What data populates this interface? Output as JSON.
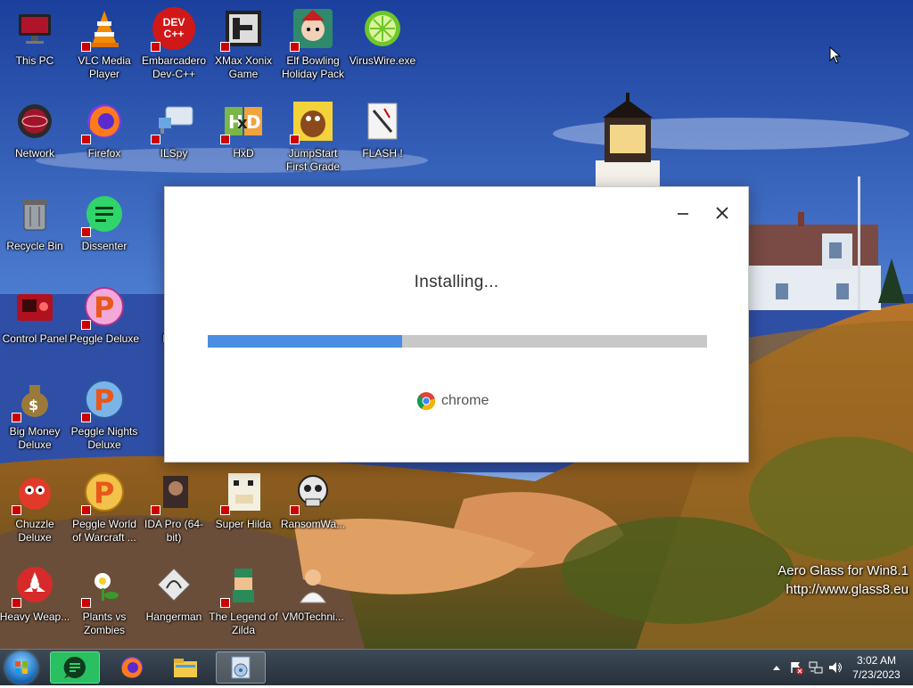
{
  "desktop": {
    "icons": [
      {
        "label": "This PC",
        "icon": "monitor-icon"
      },
      {
        "label": "VLC Media Player",
        "icon": "vlc-cone-icon"
      },
      {
        "label": "Embarcadero Dev-C++",
        "icon": "devcpp-icon",
        "badge": "DEV C++"
      },
      {
        "label": "XMax Xonix Game",
        "icon": "xonix-icon"
      },
      {
        "label": "Elf Bowling Holiday Pack",
        "icon": "elf-bowling-icon"
      },
      {
        "label": "VirusWire.exe",
        "icon": "lime-icon"
      },
      {
        "label": "Network",
        "icon": "network-icon"
      },
      {
        "label": "Firefox",
        "icon": "firefox-icon"
      },
      {
        "label": "ILSpy",
        "icon": "ilspy-icon"
      },
      {
        "label": "HxD",
        "icon": "hxd-icon"
      },
      {
        "label": "JumpStart First Grade",
        "icon": "jumpstart-icon"
      },
      {
        "label": "FLASH !",
        "icon": "flash-icon"
      },
      {
        "label": "Recycle Bin",
        "icon": "recycle-bin-icon"
      },
      {
        "label": "Dissenter",
        "icon": "dissenter-icon"
      },
      {
        "label": "d",
        "icon": "partial-icon"
      },
      {
        "label": "Control Panel",
        "icon": "control-panel-icon"
      },
      {
        "label": "Peggle Deluxe",
        "icon": "peggle-icon"
      },
      {
        "label": "Dete",
        "icon": "partial-icon"
      },
      {
        "label": "Big Money Deluxe",
        "icon": "money-bag-icon"
      },
      {
        "label": "Peggle Nights Deluxe",
        "icon": "peggle-nights-icon"
      },
      {
        "label": "ID",
        "icon": "partial-icon"
      },
      {
        "label": "Chuzzle Deluxe",
        "icon": "chuzzle-icon"
      },
      {
        "label": "Peggle World of Warcraft ...",
        "icon": "peggle-wow-icon"
      },
      {
        "label": "IDA Pro (64-bit)",
        "icon": "ida-pro-icon"
      },
      {
        "label": "Super Hilda",
        "icon": "super-hilda-icon"
      },
      {
        "label": "RansomWa...",
        "icon": "skull-icon"
      },
      {
        "label": "Heavy Weap...",
        "icon": "heavy-weapon-icon"
      },
      {
        "label": "Plants vs Zombies",
        "icon": "pvz-icon"
      },
      {
        "label": "Hangerman",
        "icon": "hangerman-icon"
      },
      {
        "label": "The Legend of Zilda",
        "icon": "zilda-icon"
      },
      {
        "label": "VM0Techni...",
        "icon": "doctor-icon"
      }
    ]
  },
  "installer": {
    "status": "Installing...",
    "progress_fraction": 0.39,
    "brand": "chrome",
    "minimize_glyph": "—",
    "close_glyph": "✕"
  },
  "watermark": {
    "line1": "Aero Glass for Win8.1",
    "line2": "http://www.glass8.eu"
  },
  "taskbar": {
    "clock_time": "3:02 AM",
    "clock_date": "7/23/2023",
    "items": [
      "dissenter-icon",
      "firefox-icon",
      "file-explorer-icon",
      "installer-icon"
    ]
  },
  "colors": {
    "progress_fill": "#4a8de3",
    "progress_track": "#c8c8c8"
  }
}
